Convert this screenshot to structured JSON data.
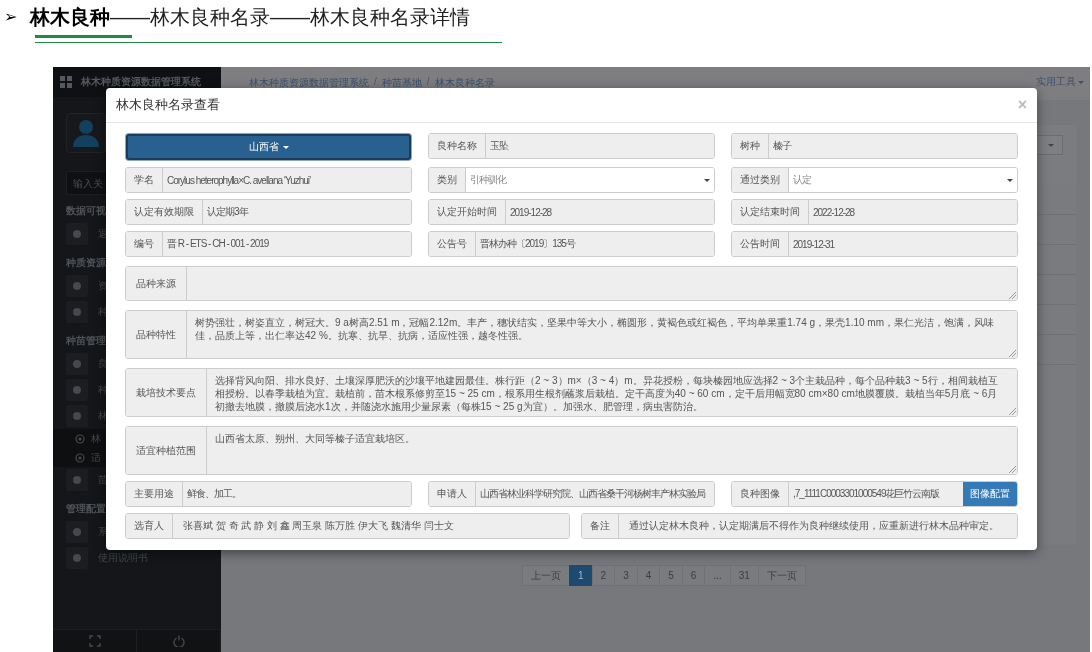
{
  "doc_heading": {
    "bullet": "➢",
    "title": "**林木良种**——林木良种名录——林木良种名录详情"
  },
  "app": {
    "brand": "林木种质资源数据管理系统",
    "search_placeholder": "输入关",
    "sidebar": [
      {
        "kind": "heading",
        "label": "数据可视"
      },
      {
        "kind": "item",
        "label": "返"
      },
      {
        "kind": "heading",
        "label": "种质资源"
      },
      {
        "kind": "item",
        "label": "资"
      },
      {
        "kind": "item",
        "label": "种"
      },
      {
        "kind": "heading",
        "label": "种苗管理"
      },
      {
        "kind": "item",
        "label": "良"
      },
      {
        "kind": "item",
        "label": "种"
      },
      {
        "kind": "item",
        "label": "林"
      },
      {
        "kind": "subitem",
        "label": "林"
      },
      {
        "kind": "subitem",
        "label": "适"
      },
      {
        "kind": "item",
        "label": "苗"
      },
      {
        "kind": "heading",
        "label": "管理配置"
      },
      {
        "kind": "item",
        "label": "系"
      },
      {
        "kind": "item",
        "label": "使用说明书"
      }
    ],
    "breadcrumb": [
      "林木种质资源数据管理系统",
      "种苗基地",
      "林木良种名录"
    ],
    "breadcrumb_separator": "/",
    "tools_menu": "实用工具",
    "pagination": [
      {
        "label": "上一页",
        "selected": false
      },
      {
        "label": "1",
        "selected": true
      },
      {
        "label": "2",
        "selected": false
      },
      {
        "label": "3",
        "selected": false
      },
      {
        "label": "4",
        "selected": false
      },
      {
        "label": "5",
        "selected": false
      },
      {
        "label": "6",
        "selected": false
      },
      {
        "label": "...",
        "selected": false
      },
      {
        "label": "31",
        "selected": false
      },
      {
        "label": "下一页",
        "selected": false
      }
    ]
  },
  "modal": {
    "title": "林木良种名录查看",
    "close": "×",
    "rows": [
      [
        {
          "kind": "dropdown",
          "value": "山西省"
        },
        {
          "kind": "text",
          "label": "良种名称",
          "value": "玉坠"
        },
        {
          "kind": "text",
          "label": "树种",
          "value": "榛子"
        }
      ],
      [
        {
          "kind": "text",
          "label": "学名",
          "value": "Corylus heterophylla×C. avellana ‘Yuzhui’"
        },
        {
          "kind": "select",
          "label": "类别",
          "value": "引种驯化"
        },
        {
          "kind": "select",
          "label": "通过类别",
          "value": "认定"
        }
      ],
      [
        {
          "kind": "text",
          "label": "认定有效期限",
          "value": "认定期3年"
        },
        {
          "kind": "text",
          "label": "认定开始时间",
          "value": "2019-12-28"
        },
        {
          "kind": "text",
          "label": "认定结束时间",
          "value": "2022-12-28"
        }
      ],
      [
        {
          "kind": "text",
          "label": "编号",
          "value": "晋 R - ETS - CH - 001 - 2019"
        },
        {
          "kind": "text",
          "label": "公告号",
          "value": "晋林办种〔2019〕135号"
        },
        {
          "kind": "text",
          "label": "公告时间",
          "value": "2019-12-31"
        }
      ],
      [
        {
          "kind": "textarea",
          "label": "品种来源"
        }
      ],
      [
        {
          "kind": "textarea",
          "label": "品种特性",
          "value": "树势强壮，树姿直立，树冠大。9 a树高2.51 m，冠幅2.12m。丰产，穗状结实，坚果中等大小，椭圆形，黄褐色或红褐色，平均单果重1.74 g，果壳1.10 mm，果仁光洁，饱满，风味佳，品质上等，出仁率达42 %。抗寒、抗旱、抗病，适应性强，越冬性强。"
        }
      ],
      [
        {
          "kind": "textarea",
          "label": "栽培技术要点",
          "value": "选择背风向阳、排水良好、土壤深厚肥沃的沙壤平地建园最佳。株行距（2 ~ 3）m×（3 ~ 4）m。异花授粉，每块榛园地应选择2 ~ 3个主栽品种，每个品种栽3 ~ 5行，相间栽植互相授粉。以春季栽植为宜。栽植前，苗木根系修剪至15 ~ 25 cm，根系用生根剂蘸浆后栽植。定干高度为40 ~ 60 cm，定干后用幅宽80 cm×80 cm地膜覆膜。栽植当年5月底 ~ 6月初撤去地膜，撤膜后浇水1次，并随浇水施用少量尿素（每株15 ~ 25 g为宜）。加强水、肥管理，病虫害防治。"
        }
      ],
      [
        {
          "kind": "textarea",
          "label": "适宜种植范围",
          "value": "山西省太原、朔州、大同等榛子适宜栽培区。"
        }
      ],
      [
        {
          "kind": "text",
          "label": "主要用途",
          "value": "鲜食、加工。"
        },
        {
          "kind": "text",
          "label": "申请人",
          "value": "山西省林业科学研究院、山西省桑干河杨树丰产林实验局"
        },
        {
          "kind": "image",
          "label": "良种图像",
          "value": ",7_1111C0003301000549花巨竹云南版",
          "button": "图像配置"
        }
      ],
      [
        {
          "kind": "text",
          "label": "选育人",
          "value": "张喜斌 贺 奇 武 静 刘 鑫 周玉泉 陈万胜  伊大飞 魏清华 闫士文"
        },
        {
          "kind": "text",
          "label": "备注",
          "value": "通过认定林木良种，认定期满后不得作为良种继续使用，应重新进行林木品种审定。"
        }
      ]
    ]
  }
}
